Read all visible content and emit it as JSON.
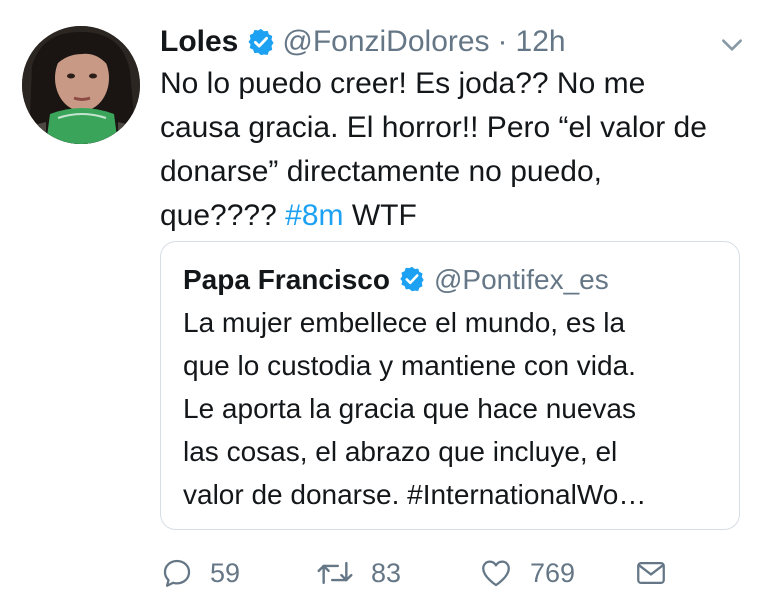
{
  "tweet": {
    "author_name": "Loles",
    "author_handle": "@FonziDolores",
    "separator": "·",
    "time": "12h",
    "text_part1": "No lo puedo creer! Es joda?? No me\ncausa gracia. El horror!! Pero “el valor de\ndonarse” directamente no puedo,\nque???? ",
    "hashtag": "#8m",
    "text_part2": " WTF"
  },
  "quoted_tweet": {
    "author_name": "Papa Francisco",
    "author_handle": "@Pontifex_es",
    "text": "La mujer embellece el mundo, es la\nque lo custodia y mantiene con vida.\nLe aporta la gracia que hace nuevas\nlas cosas, el abrazo que incluye, el\nvalor de donarse. #InternationalWo…"
  },
  "actions": {
    "replies": "59",
    "retweets": "83",
    "likes": "769"
  },
  "icons": {
    "verified": "verified-badge-icon",
    "menu": "chevron-down-icon",
    "reply": "reply-icon",
    "retweet": "retweet-icon",
    "like": "heart-icon",
    "dm": "envelope-icon"
  },
  "colors": {
    "text": "#14171a",
    "secondary": "#657786",
    "link": "#1da1f2",
    "border": "#d6dee5"
  }
}
